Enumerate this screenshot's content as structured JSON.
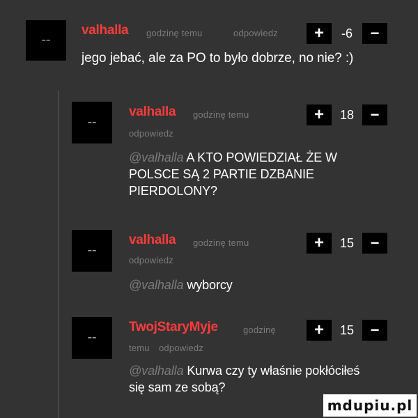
{
  "comments": [
    {
      "username": "valhalla",
      "time": "godzinę temu",
      "reply": "odpowiedz",
      "score": "-6",
      "mention": "",
      "text": "jego jebać, ale za PO to było dobrze, no nie? :)"
    },
    {
      "username": "valhalla",
      "time": "godzinę temu",
      "reply": "odpowiedz",
      "score": "18",
      "mention": "@valhalla",
      "text_lines": [
        "A KTO POWIEDZIAŁ ŻE W",
        "POLSCE SĄ 2 PARTIE DZBANIE",
        "PIERDOLONY?"
      ]
    },
    {
      "username": "valhalla",
      "time": "godzinę temu",
      "reply": "odpowiedz",
      "score": "15",
      "mention": "@valhalla",
      "text": "wyborcy"
    },
    {
      "username": "TwojStaryMyje",
      "time_line1": "godzinę",
      "time_line2": "temu",
      "reply": "odpowiedz",
      "score": "15",
      "mention": "@valhalla",
      "text_lines": [
        "Kurwa czy ty właśnie pokłóciłeś",
        "się sam ze sobą?"
      ]
    }
  ],
  "vote": {
    "plus": "+",
    "minus": "−"
  },
  "avatar_logo": "▬ ▬",
  "watermark": "mdupiu.pl",
  "colors": {
    "background": "#333333",
    "username": "#ff3b3b",
    "meta": "#7b7b7b",
    "text": "#ffffff"
  }
}
